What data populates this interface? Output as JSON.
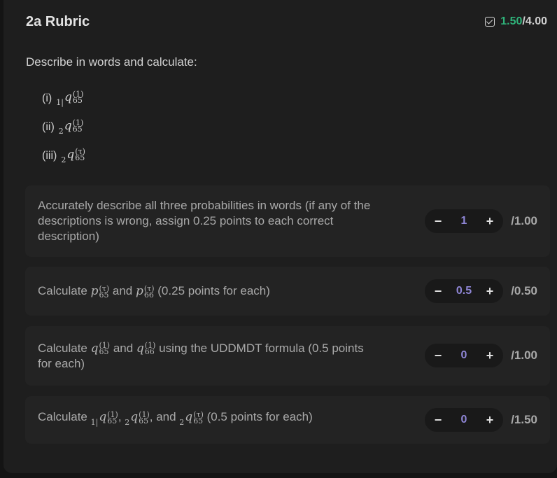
{
  "header": {
    "title": "2a Rubric",
    "score_earned": "1.50",
    "score_total": "/4.00",
    "status_icon": "checkbox-check-icon",
    "accent_color": "#2fb37a"
  },
  "prompt": "Describe in words and calculate:",
  "sub_items": [
    {
      "num": "(i)",
      "pre": "1|",
      "var": "q",
      "sup": "(1)",
      "sub": "65"
    },
    {
      "num": "(ii)",
      "pre": "2",
      "var": "q",
      "sup": "(1)",
      "sub": "65"
    },
    {
      "num": "(iii)",
      "pre": "2",
      "var": "q",
      "sup": "(τ)",
      "sub": "65"
    }
  ],
  "criteria": [
    {
      "text": "Accurately describe all three probabilities in words (if any of the descriptions is wrong, assign 0.25 points to each correct description)",
      "value": "1",
      "max": "/1.00"
    },
    {
      "t1": "Calculate ",
      "m1": {
        "var": "p",
        "sup": "(τ)",
        "sub": "65"
      },
      "t2": " and ",
      "m2": {
        "var": "p",
        "sup": "(τ)",
        "sub": "66"
      },
      "t3": " (0.25 points for each)",
      "value": "0.5",
      "max": "/0.50"
    },
    {
      "t1": "Calculate ",
      "m1": {
        "var": "q",
        "sup": "(1)",
        "sub": "65"
      },
      "t2": " and ",
      "m2": {
        "var": "q",
        "sup": "(1)",
        "sub": "66"
      },
      "t3": " using the UDDMDT formula (0.5 points for each)",
      "value": "0",
      "max": "/1.00"
    },
    {
      "t1": "Calculate ",
      "m1": {
        "pre": "1|",
        "var": "q",
        "sup": "(1)",
        "sub": "65"
      },
      "t2": ", ",
      "m2": {
        "pre": "2",
        "var": "q",
        "sup": "(1)",
        "sub": "65"
      },
      "t3": ", and ",
      "m3": {
        "pre": "2",
        "var": "q",
        "sup": "(τ)",
        "sub": "65"
      },
      "t4": " (0.5 points for each)",
      "value": "0",
      "max": "/1.50"
    }
  ],
  "stepper": {
    "minus": "−",
    "plus": "+",
    "value_color": "#8f86d6"
  }
}
